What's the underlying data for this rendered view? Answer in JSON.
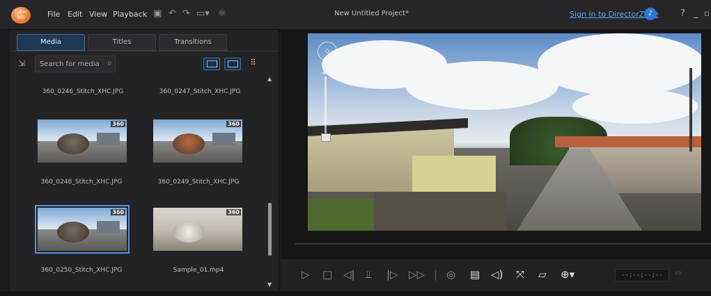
{
  "app": {
    "logo_text": "Cyber 360",
    "title": "New Untitled Project*",
    "menu": [
      "File",
      "Edit",
      "View",
      "Playback"
    ],
    "signin": "Sign in to DirectorZone",
    "help": "?",
    "minimize": "_",
    "restore": "▫"
  },
  "tabs": [
    {
      "label": "Media",
      "active": true
    },
    {
      "label": "Titles",
      "active": false
    },
    {
      "label": "Transitions",
      "active": false
    }
  ],
  "search": {
    "placeholder": "Search for media",
    "value": ""
  },
  "media": [
    {
      "caption": "360_0246_Stitch_XHC.JPG",
      "badge": "",
      "thumb": false,
      "selected": false
    },
    {
      "caption": "360_0247_Stitch_XHC.JPG",
      "badge": "",
      "thumb": false,
      "selected": false
    },
    {
      "caption": "360_0248_Stitch_XHC.JPG",
      "badge": "360",
      "thumb": true,
      "selected": false
    },
    {
      "caption": "360_0249_Stitch_XHC.JPG",
      "badge": "360",
      "thumb": true,
      "selected": false
    },
    {
      "caption": "360_0250_Stitch_XHC.JPG",
      "badge": "360",
      "thumb": true,
      "selected": true
    },
    {
      "caption": "Sample_01.mp4",
      "badge": "360",
      "thumb": true,
      "selected": false
    }
  ],
  "player": {
    "timecode": "--;--;--;--",
    "icons": [
      "play-icon",
      "stop-icon",
      "previous-frame-icon",
      "split-icon",
      "next-frame-icon",
      "fast-forward-icon",
      "snapshot-icon",
      "subtitles-icon",
      "volume-icon",
      "fullscreen-icon",
      "undock-icon",
      "360-view-icon"
    ]
  },
  "colors": {
    "accent": "#4c95e8",
    "link": "#5aa8ff"
  }
}
